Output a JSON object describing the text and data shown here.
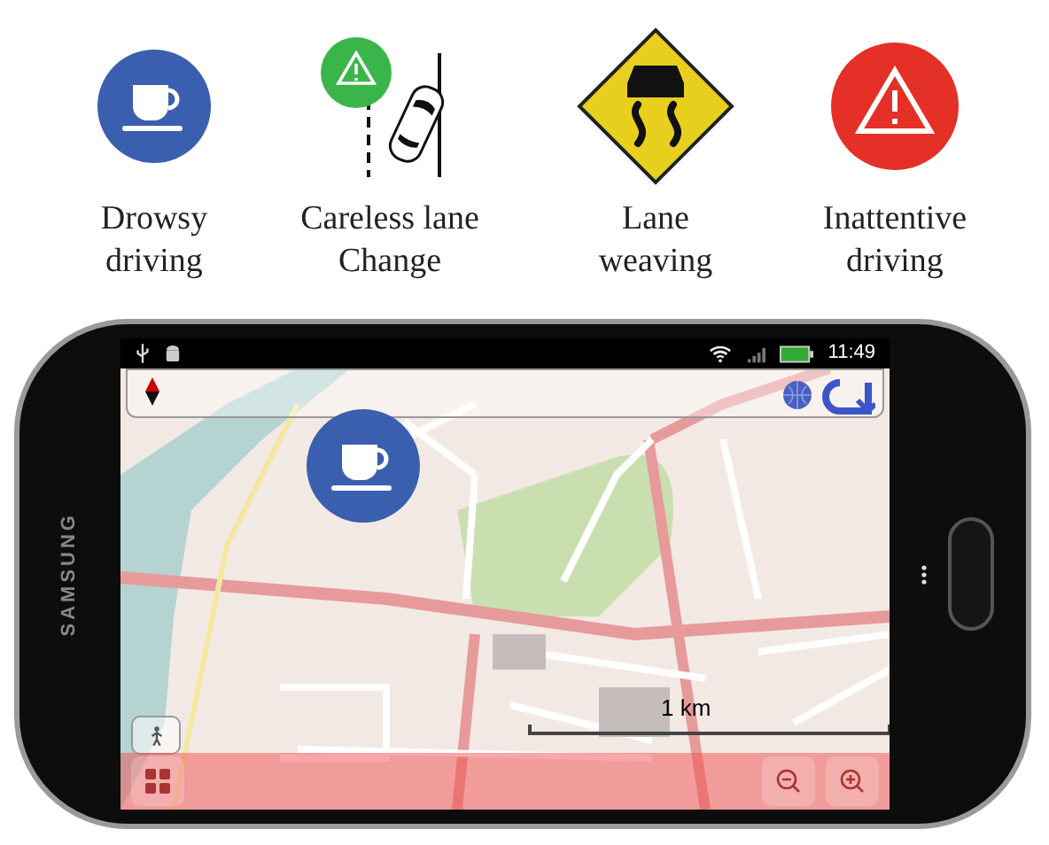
{
  "alerts": [
    {
      "kind": "drowsy",
      "lines": [
        "Drowsy",
        "driving"
      ]
    },
    {
      "kind": "lane_change",
      "lines": [
        "Careless lane",
        "Change"
      ]
    },
    {
      "kind": "weaving",
      "lines": [
        "Lane",
        "weaving"
      ]
    },
    {
      "kind": "inattentive",
      "lines": [
        "Inattentive",
        "driving"
      ]
    }
  ],
  "phone": {
    "brand": "SAMSUNG",
    "status_bar": {
      "time": "11:49"
    },
    "map": {
      "coffee_alert_shown": true,
      "scale": "1 km"
    }
  }
}
